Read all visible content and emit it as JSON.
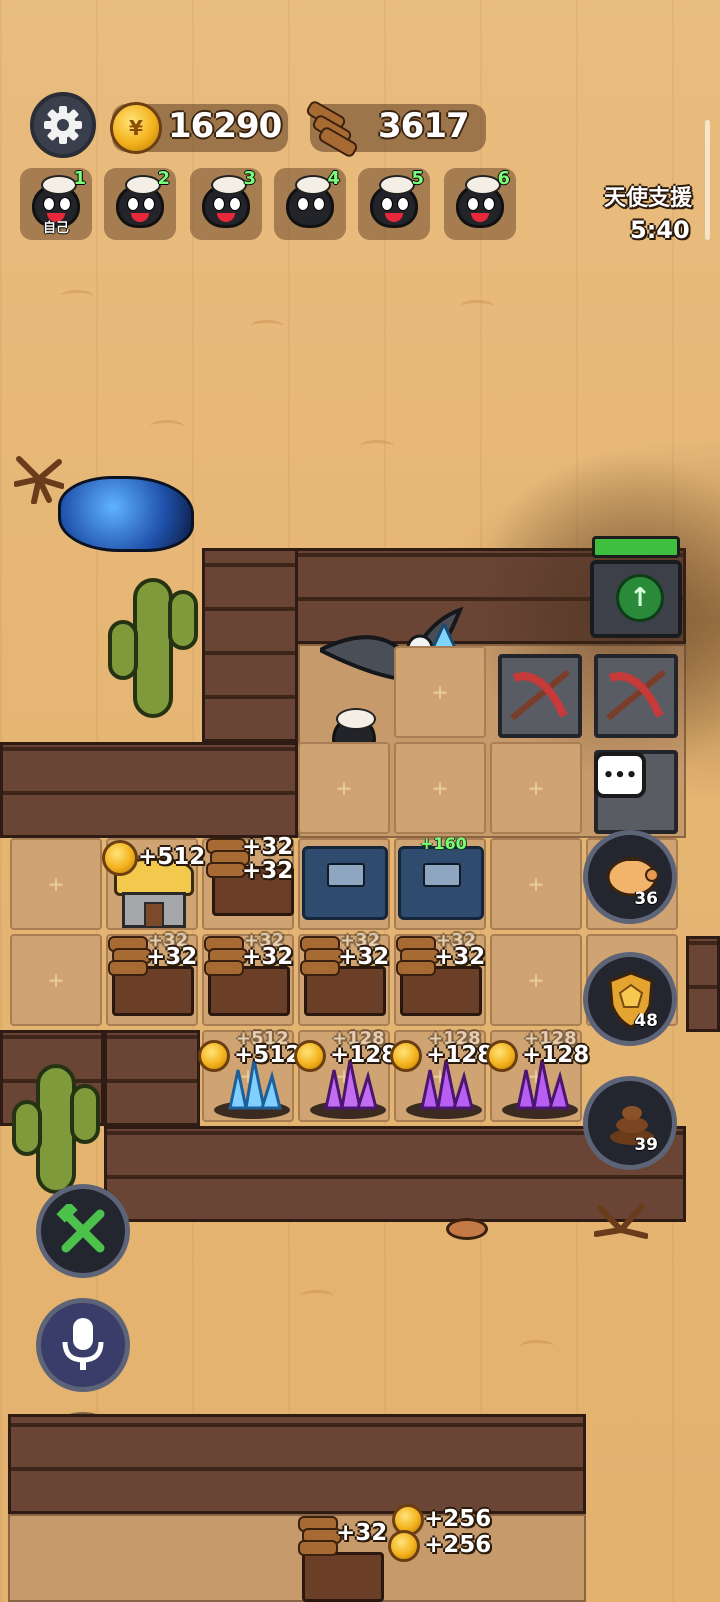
{
  "hud": {
    "gold_value": "16290",
    "wood_value": "3617",
    "angel_support_label": "天使支援",
    "angel_support_timer": "5:40"
  },
  "players": [
    {
      "number": "1",
      "tag": "自己"
    },
    {
      "number": "2",
      "tag": ""
    },
    {
      "number": "3",
      "tag": ""
    },
    {
      "number": "4",
      "tag": ""
    },
    {
      "number": "5",
      "tag": ""
    },
    {
      "number": "6",
      "tag": ""
    }
  ],
  "production": {
    "house_gold": "+512",
    "workshop_top_a": "+32",
    "workshop_top_b": "+32",
    "anvil_bonus": "+160",
    "row2": [
      "+32",
      "+32",
      "+32",
      "+32"
    ],
    "row2_ghost": [
      "+32",
      "+32",
      "+32",
      "+32"
    ],
    "crystals": [
      "+512",
      "+128",
      "+128",
      "+128"
    ],
    "crystals_ghost": [
      "+512",
      "+128",
      "+128",
      "+128"
    ],
    "bottom_wood": "+32",
    "bottom_gold_a": "+256",
    "bottom_gold_b": "+256"
  },
  "side_buttons": {
    "piggy_bank_count": "36",
    "shield_count": "48",
    "poop_count": "39"
  },
  "colors": {
    "sand": "#e7b877",
    "wall": "#5b3a2c",
    "gold": "#f3b21c",
    "green_bar": "#3fbf3f",
    "plus_green": "#7bff7b"
  },
  "icons": [
    "gear-icon",
    "gold-coin-icon",
    "wood-logs-icon",
    "chat-bubble-icon",
    "piggy-bank-icon",
    "shield-icon",
    "poop-icon",
    "wrench-hammer-icon",
    "microphone-icon",
    "eye-icon",
    "upgrade-arrow-icon",
    "crossbow-icon"
  ]
}
